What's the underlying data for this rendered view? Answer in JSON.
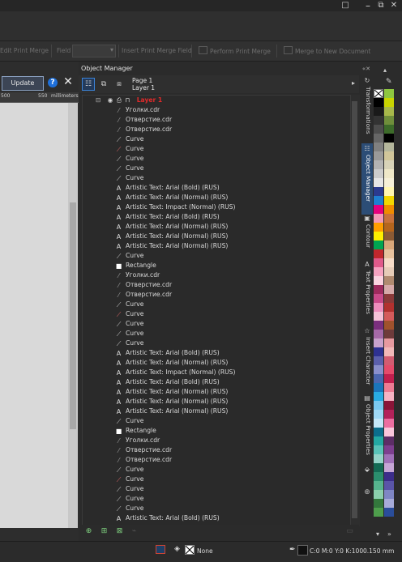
{
  "window": {
    "controls": [
      "□",
      "⧉",
      "✕"
    ]
  },
  "print_merge": {
    "edit": "Edit Print Merge",
    "field_label": "Field",
    "field_value": "",
    "insert": "Insert Print Merge Field",
    "perform": "Perform Print Merge",
    "merge_new": "Merge to New Document"
  },
  "left_panel": {
    "update_label": "Update",
    "help_label": "?",
    "close_label": "✕",
    "ruler": {
      "tick_500": "500",
      "tick_550": "550",
      "unit": "millimeters"
    }
  },
  "object_manager": {
    "title": "Object Manager",
    "page": "Page 1",
    "layer": "Layer 1",
    "tree_layer": "Layer 1",
    "tree": [
      {
        "icon": "cdr",
        "label": "Уголки.cdr"
      },
      {
        "icon": "cdr",
        "label": "Отверстие.cdr"
      },
      {
        "icon": "cdr",
        "label": "Отверстие.cdr"
      },
      {
        "icon": "curve",
        "label": "Curve"
      },
      {
        "icon": "curve-red",
        "label": "Curve"
      },
      {
        "icon": "curve",
        "label": "Curve"
      },
      {
        "icon": "curve",
        "label": "Curve"
      },
      {
        "icon": "curve",
        "label": "Curve"
      },
      {
        "icon": "text",
        "label": "Artistic Text: Arial (Bold) (RUS)"
      },
      {
        "icon": "text",
        "label": "Artistic Text: Arial (Normal) (RUS)"
      },
      {
        "icon": "text",
        "label": "Artistic Text: Impact (Normal) (RUS)"
      },
      {
        "icon": "text",
        "label": "Artistic Text: Arial (Bold) (RUS)"
      },
      {
        "icon": "text",
        "label": "Artistic Text: Arial (Normal) (RUS)"
      },
      {
        "icon": "text",
        "label": "Artistic Text: Arial (Normal) (RUS)"
      },
      {
        "icon": "text",
        "label": "Artistic Text: Arial (Normal) (RUS)"
      },
      {
        "icon": "curve",
        "label": "Curve"
      },
      {
        "icon": "rect",
        "label": "Rectangle"
      },
      {
        "icon": "cdr",
        "label": "Уголки.cdr"
      },
      {
        "icon": "cdr",
        "label": "Отверстие.cdr"
      },
      {
        "icon": "cdr",
        "label": "Отверстие.cdr"
      },
      {
        "icon": "curve",
        "label": "Curve"
      },
      {
        "icon": "curve-red",
        "label": "Curve"
      },
      {
        "icon": "curve",
        "label": "Curve"
      },
      {
        "icon": "curve",
        "label": "Curve"
      },
      {
        "icon": "curve",
        "label": "Curve"
      },
      {
        "icon": "text",
        "label": "Artistic Text: Arial (Bold) (RUS)"
      },
      {
        "icon": "text",
        "label": "Artistic Text: Arial (Normal) (RUS)"
      },
      {
        "icon": "text",
        "label": "Artistic Text: Impact (Normal) (RUS)"
      },
      {
        "icon": "text",
        "label": "Artistic Text: Arial (Bold) (RUS)"
      },
      {
        "icon": "text",
        "label": "Artistic Text: Arial (Normal) (RUS)"
      },
      {
        "icon": "text",
        "label": "Artistic Text: Arial (Normal) (RUS)"
      },
      {
        "icon": "text",
        "label": "Artistic Text: Arial (Normal) (RUS)"
      },
      {
        "icon": "curve",
        "label": "Curve"
      },
      {
        "icon": "rect",
        "label": "Rectangle"
      },
      {
        "icon": "cdr",
        "label": "Уголки.cdr"
      },
      {
        "icon": "cdr",
        "label": "Отверстие.cdr"
      },
      {
        "icon": "cdr",
        "label": "Отверстие.cdr"
      },
      {
        "icon": "curve",
        "label": "Curve"
      },
      {
        "icon": "curve-red",
        "label": "Curve"
      },
      {
        "icon": "curve",
        "label": "Curve"
      },
      {
        "icon": "curve",
        "label": "Curve"
      },
      {
        "icon": "curve",
        "label": "Curve"
      },
      {
        "icon": "text",
        "label": "Artistic Text: Arial (Bold) (RUS)"
      }
    ]
  },
  "docker_tabs": [
    {
      "label": "Transformations",
      "icon": "transform-icon"
    },
    {
      "label": "Object Manager",
      "icon": "object-manager-icon",
      "active": true
    },
    {
      "label": "Contour",
      "icon": "contour-icon"
    },
    {
      "label": "Text Properties",
      "icon": "text-properties-icon"
    },
    {
      "label": "Insert Character",
      "icon": "star-icon"
    },
    {
      "label": "Object Properties",
      "icon": "object-properties-icon"
    }
  ],
  "palette_colors": [
    [
      "#ffffff",
      "#8ec63f"
    ],
    [
      "#000000",
      "#c8d400"
    ],
    [
      "#1a1a1a",
      "#a7b84a"
    ],
    [
      "#333333",
      "#6f8e3b"
    ],
    [
      "#4d4d4d",
      "#3d6b2a"
    ],
    [
      "#666666",
      "#000000"
    ],
    [
      "#808080",
      "#b5b79c"
    ],
    [
      "#999999",
      "#d1c69a"
    ],
    [
      "#b3b3b3",
      "#d8d3b8"
    ],
    [
      "#cccccc",
      "#efe8c8"
    ],
    [
      "#e6e6e6",
      "#f6f0d8"
    ],
    [
      "#2b3b8f",
      "#fff6b0"
    ],
    [
      "#1f7fd0",
      "#f2d700"
    ],
    [
      "#e6007e",
      "#f08c00"
    ],
    [
      "#f39ab7",
      "#c9723a"
    ],
    [
      "#ff9e00",
      "#b5651d"
    ],
    [
      "#ffee00",
      "#8a5a34"
    ],
    [
      "#00a651",
      "#d8a77a"
    ],
    [
      "#c1272d",
      "#e7c29e"
    ],
    [
      "#e05a8a",
      "#f6dcc8"
    ],
    [
      "#f6a2c0",
      "#e6ccb8"
    ],
    [
      "#fbd3e0",
      "#b08a70"
    ],
    [
      "#9e2a5e",
      "#d6a9a9"
    ],
    [
      "#c94a8a",
      "#8a3a3a"
    ],
    [
      "#ed8dbd",
      "#b1312f"
    ],
    [
      "#f5c2d8",
      "#d45b5b"
    ],
    [
      "#7b2f7e",
      "#a0522d"
    ],
    [
      "#a66aa8",
      "#6e3b3b"
    ],
    [
      "#c9a2cc",
      "#e79aa0"
    ],
    [
      "#2e3192",
      "#f2b8b8"
    ],
    [
      "#5b5fad",
      "#d35c71"
    ],
    [
      "#8a8fcc",
      "#e54b6b"
    ],
    [
      "#4c66af",
      "#c21f4e"
    ],
    [
      "#1b75bb",
      "#ed7b93"
    ],
    [
      "#29abe2",
      "#f7b3c3"
    ],
    [
      "#7ac9f0",
      "#8a1538"
    ],
    [
      "#9fd8f5",
      "#b3225a"
    ],
    [
      "#c5e8f9",
      "#ec6ea0"
    ],
    [
      "#0b6e8c",
      "#f9c6da"
    ],
    [
      "#23a9a3",
      "#5d2d66"
    ],
    [
      "#59c3b8",
      "#7e3f8f"
    ],
    [
      "#95d4c9",
      "#a070b8"
    ],
    [
      "#146a54",
      "#c6a6d6"
    ],
    [
      "#2b8e6e",
      "#3c2d8a"
    ],
    [
      "#56b48e",
      "#5a55a8"
    ],
    [
      "#8bcfac",
      "#7f86c4"
    ],
    [
      "#33773c",
      "#a7abd9"
    ],
    [
      "#4e9e4c",
      "#2a4d9a"
    ]
  ],
  "status": {
    "fill": "None",
    "outline": "C:0 M:0 Y:0 K:100",
    "outline_width": "0.150 mm"
  }
}
